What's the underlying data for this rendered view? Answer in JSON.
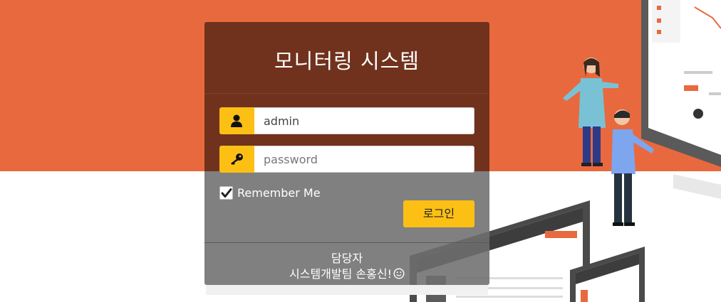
{
  "login": {
    "title": "모니터링 시스템",
    "username": {
      "value": "admin",
      "placeholder": "admin"
    },
    "password": {
      "value": "",
      "placeholder": "password"
    },
    "remember_label": "Remember Me",
    "remember_checked": true,
    "login_button": "로그인"
  },
  "footer": {
    "role": "담당자",
    "contact": "시스템개발팀 손홍신!"
  },
  "colors": {
    "background_orange": "#e9693e",
    "panel_brown": "#70321d",
    "accent_yellow": "#fcc015"
  },
  "icons": [
    "user-icon",
    "key-icon",
    "check-icon",
    "smiley-icon"
  ]
}
